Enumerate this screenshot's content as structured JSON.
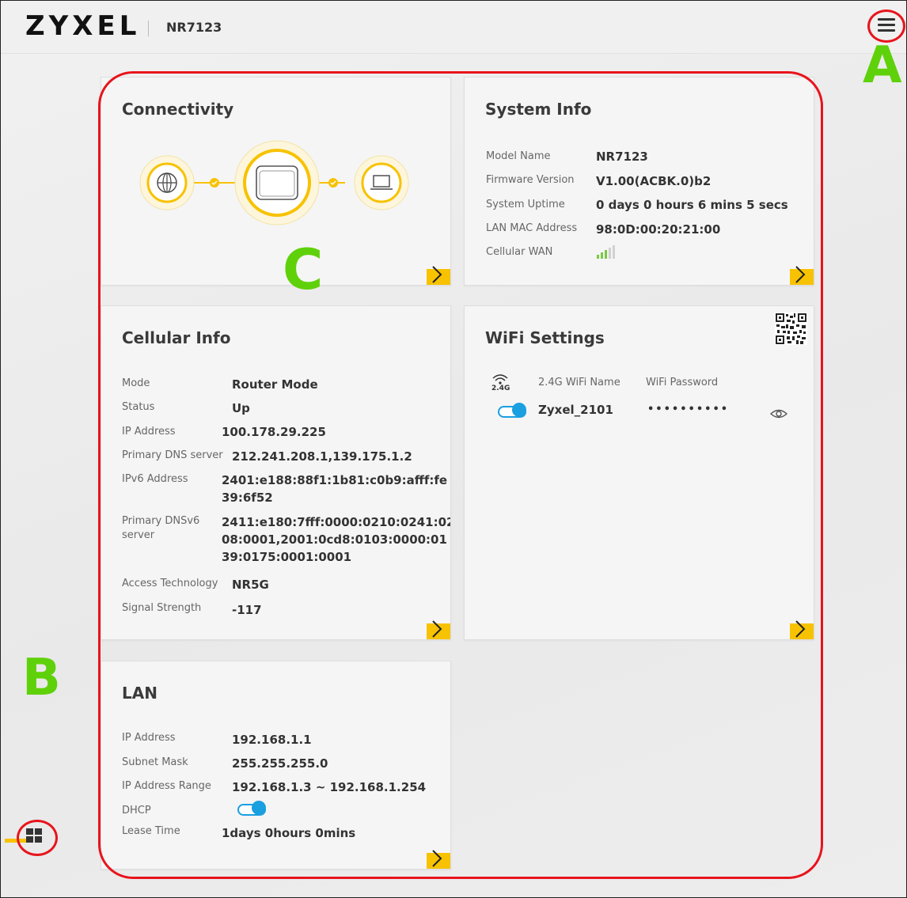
{
  "header": {
    "brand": "ZYXEL",
    "model": "NR7123",
    "menu_icon": "hamburger-menu-icon"
  },
  "callouts": {
    "a": "A",
    "b": "B",
    "c": "C"
  },
  "connectivity": {
    "title": "Connectivity",
    "icons": [
      "globe-icon",
      "router-icon",
      "laptop-icon"
    ]
  },
  "system_info": {
    "title": "System Info",
    "rows": [
      {
        "label": "Model Name",
        "value": "NR7123"
      },
      {
        "label": "Firmware Version",
        "value": "V1.00(ACBK.0)b2"
      },
      {
        "label": "System Uptime",
        "value": "0 days 0 hours 6 mins 5 secs"
      },
      {
        "label": "LAN MAC Address",
        "value": "98:0D:00:20:21:00"
      },
      {
        "label": "Cellular WAN",
        "value": ""
      }
    ]
  },
  "cellular_info": {
    "title": "Cellular Info",
    "rows": [
      {
        "label": "Mode",
        "value": "Router Mode"
      },
      {
        "label": "Status",
        "value": "Up"
      },
      {
        "label": "IP Address",
        "value": "100.178.29.225"
      },
      {
        "label": "Primary DNS server",
        "value": "212.241.208.1,139.175.1.2"
      },
      {
        "label": "IPv6 Address",
        "value": "2401:e188:88f1:1b81:c0b9:afff:fe 39:6f52"
      },
      {
        "label": "Primary DNSv6 server",
        "value": "2411:e180:7fff:0000:0210:0241:02 08:0001,2001:0cd8:0103:0000:01 39:0175:0001:0001"
      },
      {
        "label": "Access Technology",
        "value": "NR5G"
      },
      {
        "label": "Signal Strength",
        "value": "-117"
      }
    ]
  },
  "wifi_settings": {
    "title": "WiFi Settings",
    "band_badge": "2.4G",
    "name_header": "2.4G WiFi Name",
    "password_header": "WiFi Password",
    "wifi_name": "Zyxel_2101",
    "wifi_password": "••••••••••",
    "enabled": true
  },
  "lan": {
    "title": "LAN",
    "rows": [
      {
        "label": "IP Address",
        "value": "192.168.1.1"
      },
      {
        "label": "Subnet Mask",
        "value": "255.255.255.0"
      },
      {
        "label": "IP Address Range",
        "value": "192.168.1.3 ~ 192.168.1.254"
      },
      {
        "label": "DHCP",
        "value": ""
      },
      {
        "label": "Lease Time",
        "value": "1days 0hours 0mins"
      }
    ]
  },
  "colors": {
    "accent_yellow": "#f7c200",
    "toggle_blue": "#1a9fe0",
    "callout_red": "#e8141c",
    "callout_green": "#5fd10a"
  }
}
